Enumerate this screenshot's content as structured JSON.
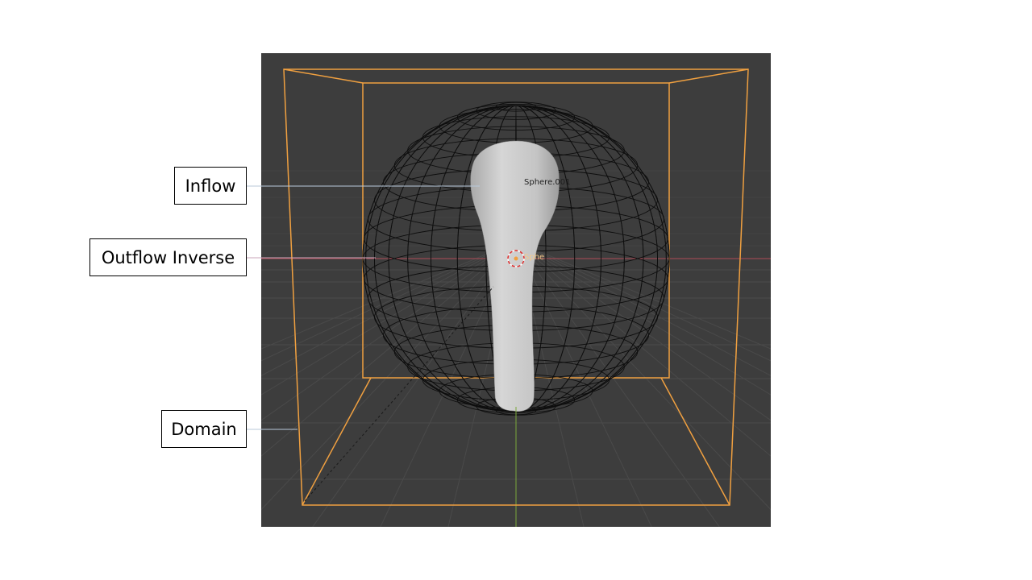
{
  "callouts": {
    "inflow": "Inflow",
    "outflow_inverse": "Outflow Inverse",
    "domain": "Domain"
  },
  "viewport": {
    "object_labels": {
      "sphere_001": "Sphere.001",
      "sphere": "Sphe"
    },
    "colors": {
      "background": "#3d3d3d",
      "domain_outline": "#f0a040",
      "wireframe": "#0e0e0e",
      "inflow_mesh": "#c8c8c8",
      "x_axis": "#b04a56",
      "y_axis": "#7aa83a",
      "leader_line": "#b9c9da"
    }
  }
}
